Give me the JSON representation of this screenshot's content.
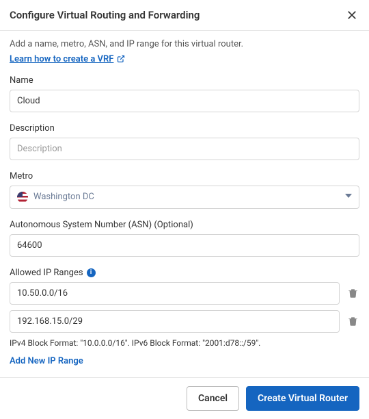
{
  "header": {
    "title": "Configure Virtual Routing and Forwarding"
  },
  "intro": {
    "text": "Add a name, metro, ASN, and IP range for this virtual router.",
    "link_text": "Learn how to create a VRF"
  },
  "form": {
    "name": {
      "label": "Name",
      "value": "Cloud"
    },
    "description": {
      "label": "Description",
      "placeholder": "Description",
      "value": ""
    },
    "metro": {
      "label": "Metro",
      "selected": "Washington DC"
    },
    "asn": {
      "label": "Autonomous System Number (ASN) (Optional)",
      "value": "64600"
    },
    "ip_ranges": {
      "label": "Allowed IP Ranges",
      "items": [
        "10.50.0.0/16",
        "192.168.15.0/29"
      ],
      "hint": "IPv4 Block Format: \"10.0.0.0/16\". IPv6 Block Format: \"2001:d78::/59\".",
      "add_label": "Add New IP Range"
    }
  },
  "footer": {
    "cancel": "Cancel",
    "submit": "Create Virtual Router"
  }
}
